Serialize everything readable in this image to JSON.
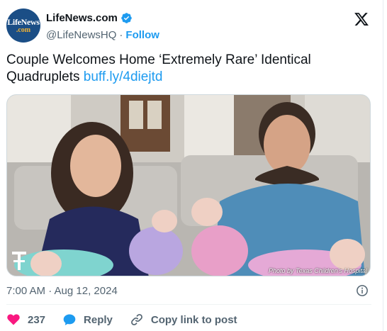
{
  "account": {
    "display_name": "LifeNews.com",
    "handle": "@LifeNewsHQ",
    "separator": "·",
    "follow_label": "Follow",
    "avatar_text_top": "LifeNews",
    "avatar_text_bottom": ".com",
    "verified": true
  },
  "tweet": {
    "text": "Couple Welcomes Home ‘Extremely Rare’ Identical Quadruplets ",
    "link": "buff.ly/4diejtd",
    "photo_credit": "Photo by Texas Children's Hospital",
    "timestamp": "7:00 AM · Aug 12, 2024"
  },
  "actions": {
    "like_count": "237",
    "reply_label": "Reply",
    "copy_link_label": "Copy link to post"
  },
  "icons": {
    "brand": "x-logo-icon",
    "verified": "verified-badge-icon",
    "info": "info-icon",
    "like": "heart-icon",
    "reply": "reply-bubble-icon",
    "copy": "link-icon"
  },
  "colors": {
    "accent": "#1d9bf0",
    "like": "#f91880",
    "text_secondary": "#536471"
  }
}
